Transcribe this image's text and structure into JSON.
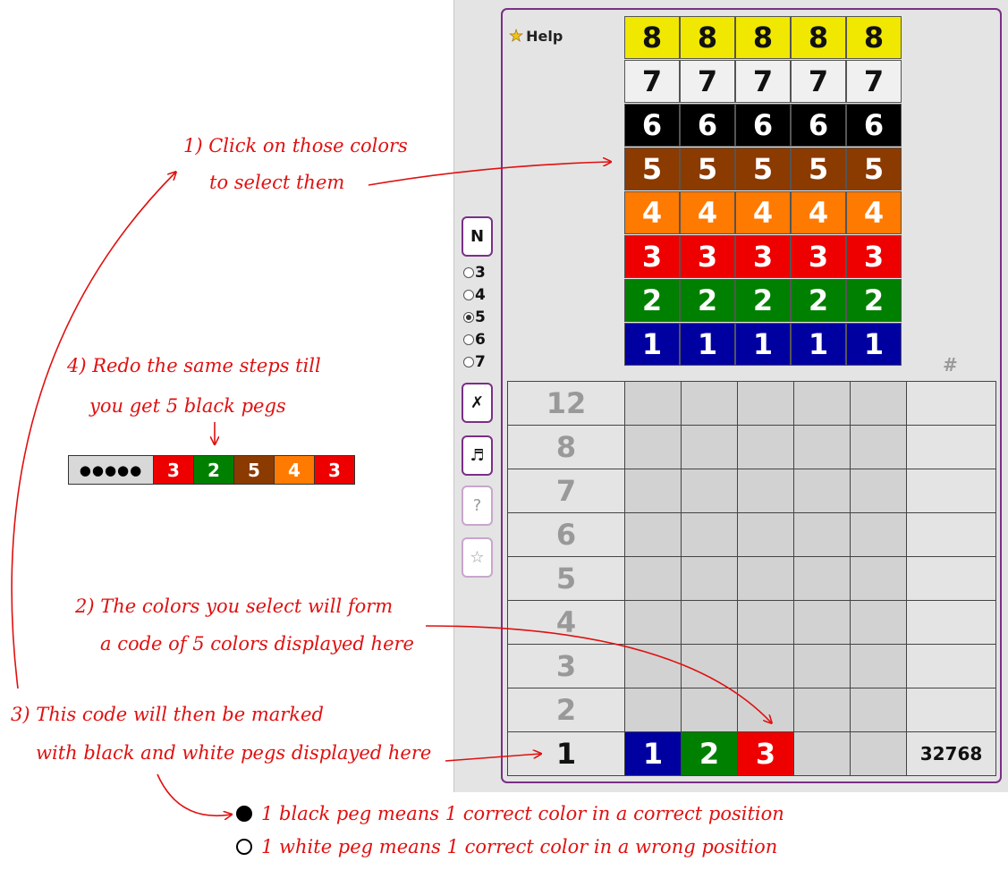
{
  "help": {
    "label": "Help",
    "icon": "star-icon"
  },
  "palette": [
    {
      "value": "8",
      "bg": "#f0e800",
      "fg": "#111111"
    },
    {
      "value": "7",
      "bg": "#f0f0f0",
      "fg": "#111111"
    },
    {
      "value": "6",
      "bg": "#000000",
      "fg": "#ffffff"
    },
    {
      "value": "5",
      "bg": "#8b3a00",
      "fg": "#ffffff"
    },
    {
      "value": "4",
      "bg": "#ff7a00",
      "fg": "#ffffff"
    },
    {
      "value": "3",
      "bg": "#ee0000",
      "fg": "#ffffff"
    },
    {
      "value": "2",
      "bg": "#008000",
      "fg": "#ffffff"
    },
    {
      "value": "1",
      "bg": "#0000a0",
      "fg": "#ffffff"
    }
  ],
  "controls": {
    "new_label": "N",
    "radio_options": [
      "3",
      "4",
      "5",
      "6",
      "7"
    ],
    "radio_selected": "5",
    "clear_label": "✗",
    "sound_label": "♬",
    "hint_label": "?",
    "fav_label": "☆"
  },
  "board": {
    "hash_label": "#",
    "rows": [
      "12",
      "8",
      "7",
      "6",
      "5",
      "4",
      "3",
      "2",
      "1"
    ],
    "active_row": "1",
    "current_guess": [
      {
        "value": "1",
        "bg": "#0000a0"
      },
      {
        "value": "2",
        "bg": "#008000"
      },
      {
        "value": "3",
        "bg": "#ee0000"
      }
    ],
    "count": "32768"
  },
  "annotations": {
    "step1_line1": "1) Click on those colors",
    "step1_line2": "to select them",
    "step4_line1": "4) Redo the same steps till",
    "step4_line2": "you get 5 black pegs",
    "step2_line1": "2) The colors you select will form",
    "step2_line2": "a code of 5 colors displayed here",
    "step3_line1": "3) This code will then be marked",
    "step3_line2": "with black and white pegs displayed here",
    "legend_black": "1 black peg means 1 correct color in a correct position",
    "legend_white": "1 white peg means 1 correct color in a wrong position"
  },
  "example": {
    "pegs": "●●●●●",
    "cells": [
      {
        "value": "3",
        "bg": "#ee0000"
      },
      {
        "value": "2",
        "bg": "#008000"
      },
      {
        "value": "5",
        "bg": "#8b3a00"
      },
      {
        "value": "4",
        "bg": "#ff7a00"
      },
      {
        "value": "3",
        "bg": "#ee0000"
      }
    ]
  }
}
